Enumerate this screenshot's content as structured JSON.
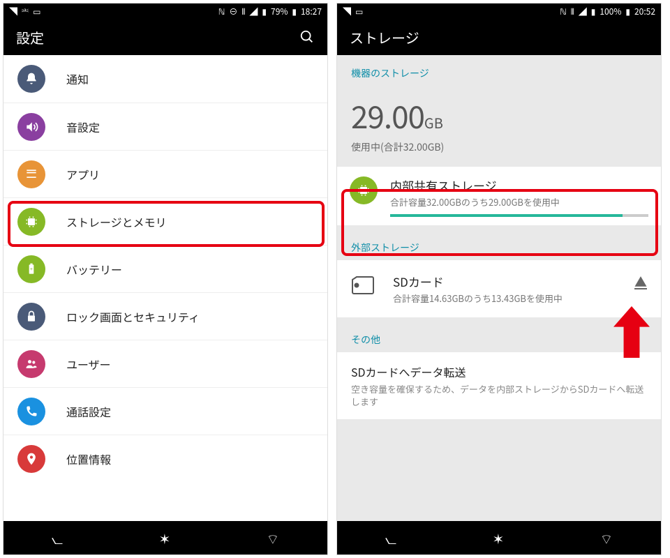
{
  "left": {
    "status": {
      "battery": "79%",
      "time": "18:27"
    },
    "header": {
      "title": "設定"
    },
    "items": [
      {
        "label": "通知",
        "color": "#4a5a78",
        "icon": "bell"
      },
      {
        "label": "音設定",
        "color": "#8a3fa0",
        "icon": "sound"
      },
      {
        "label": "アプリ",
        "color": "#e89437",
        "icon": "apps"
      },
      {
        "label": "ストレージとメモリ",
        "color": "#86b926",
        "icon": "chip"
      },
      {
        "label": "バッテリー",
        "color": "#86b926",
        "icon": "battery"
      },
      {
        "label": "ロック画面とセキュリティ",
        "color": "#4a5a78",
        "icon": "lock"
      },
      {
        "label": "ユーザー",
        "color": "#c63a6e",
        "icon": "users"
      },
      {
        "label": "通話設定",
        "color": "#1a91e0",
        "icon": "phone"
      },
      {
        "label": "位置情報",
        "color": "#d83a3a",
        "icon": "pin"
      }
    ]
  },
  "right": {
    "status": {
      "battery": "100%",
      "time": "20:52"
    },
    "header": {
      "title": "ストレージ"
    },
    "device_section": "機器のストレージ",
    "used_value": "29.00",
    "used_unit": "GB",
    "used_sub": "使用中(合計32.00GB)",
    "internal": {
      "title": "内部共有ストレージ",
      "sub": "合計容量32.00GBのうち29.00GBを使用中",
      "progress_pct": 90
    },
    "external_section": "外部ストレージ",
    "sd": {
      "title": "SDカード",
      "sub": "合計容量14.63GBのうち13.43GBを使用中"
    },
    "other_section": "その他",
    "transfer": {
      "title": "SDカードへデータ転送",
      "sub": "空き容量を確保するため、データを内部ストレージからSDカードへ転送します"
    }
  }
}
